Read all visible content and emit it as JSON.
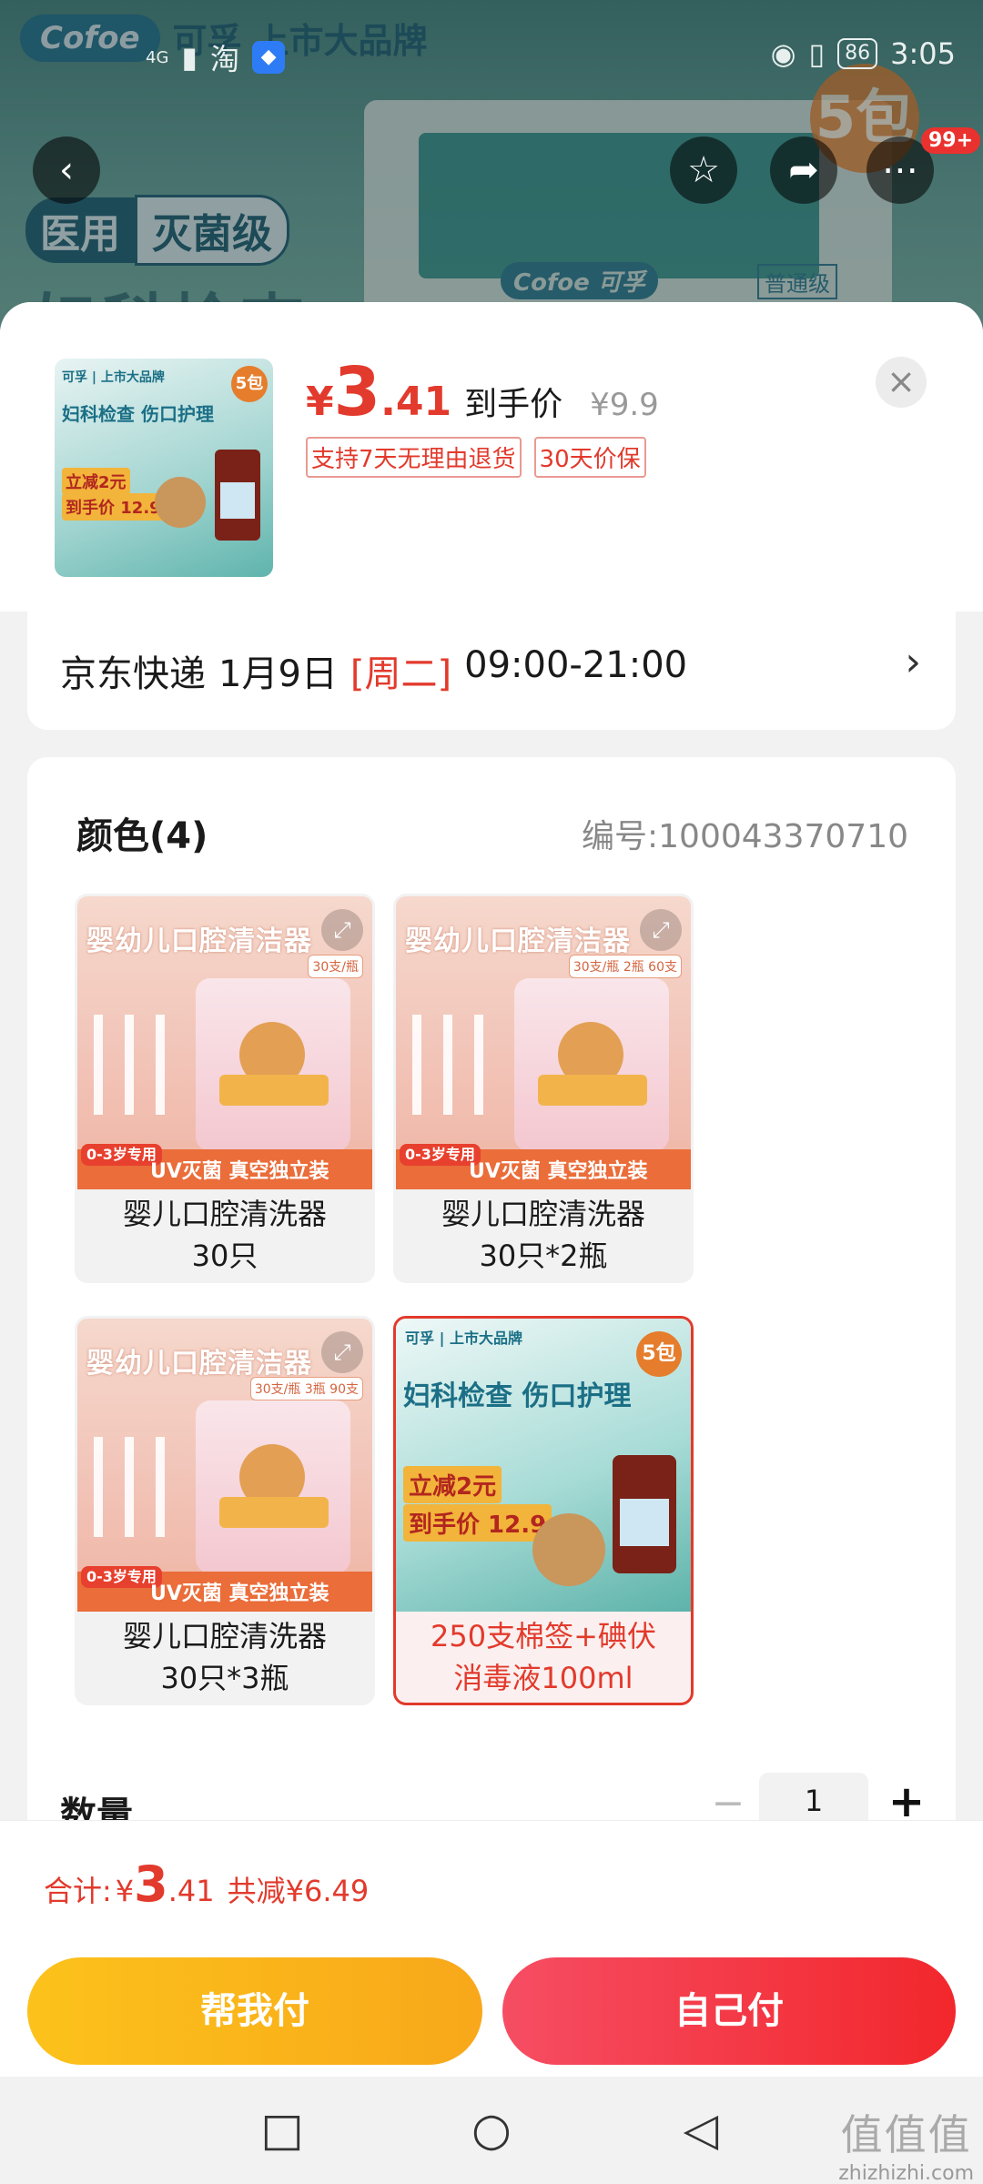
{
  "background": {
    "brand_logo": "Cofoe",
    "brand_name": "可孚",
    "brand_tagline": "上市大品牌",
    "medical_tag_a": "医用",
    "medical_tag_b": "灭菌级",
    "box_logo": "Cofoe 可孚",
    "box_label": "普通级",
    "bag_badge": "5包",
    "title_partial": "妇科检查"
  },
  "status_bar": {
    "signal": "4G",
    "app_icon": "淘",
    "time": "3:05",
    "battery": "86"
  },
  "nav": {
    "notif_badge": "99+"
  },
  "product": {
    "price_currency": "¥",
    "price_int": "3",
    "price_dec": ".41",
    "price_suffix": "到手价",
    "original_price": "¥9.9",
    "tags": [
      "支持7天无理由退货",
      "30天价保"
    ],
    "thumb_text": {
      "brand": "可孚 | 上市大品牌",
      "headline": "妇科检查 伤口护理",
      "promo": "立减2元",
      "promo_price": "到手价 12.9",
      "bag_badge": "5包"
    }
  },
  "shipping": {
    "carrier": "京东快递",
    "date": "1月9日",
    "weekday": "[周二]",
    "time_window": "09:00-21:00"
  },
  "options": {
    "color_title": "颜色(4)",
    "sku": "编号:100043370710",
    "variants": [
      {
        "line1": "婴儿口腔清洗器",
        "line2": "30只",
        "img_title": "婴幼儿口腔清洁器",
        "count": "30支/瓶",
        "selected": false
      },
      {
        "line1": "婴儿口腔清洗器",
        "line2": "30只*2瓶",
        "img_title": "婴幼儿口腔清洁器",
        "count": "30支/瓶 2瓶 60支",
        "selected": false
      },
      {
        "line1": "婴儿口腔清洗器",
        "line2": "30只*3瓶",
        "img_title": "婴幼儿口腔清洁器",
        "count": "30支/瓶 3瓶 90支",
        "selected": false
      },
      {
        "line1": "250支棉签+碘伏",
        "line2": "消毒液100ml",
        "img_title": "妇科检查 伤口护理",
        "count": "5包",
        "selected": true
      }
    ],
    "pink_band_age": "0-3岁专用",
    "pink_band_text": "UV灭菌 真空独立装",
    "teal_promo": "立减2元",
    "teal_promo_price": "到手价 12.9",
    "teal_brand": "可孚 | 上市大品牌",
    "quantity_label": "数量",
    "quantity_value": "1"
  },
  "footer": {
    "total_label": "合计:",
    "total_currency": "¥",
    "total_int": "3",
    "total_dec": ".41",
    "saving": "共减¥6.49",
    "help_pay": "帮我付",
    "self_pay": "自己付"
  },
  "watermark": {
    "logo": "值值值",
    "site": "zhizhizhi.com"
  },
  "colors": {
    "accent_red": "#e23a2c",
    "help_btn": "#f8a81a",
    "self_btn": "#f2272c"
  }
}
